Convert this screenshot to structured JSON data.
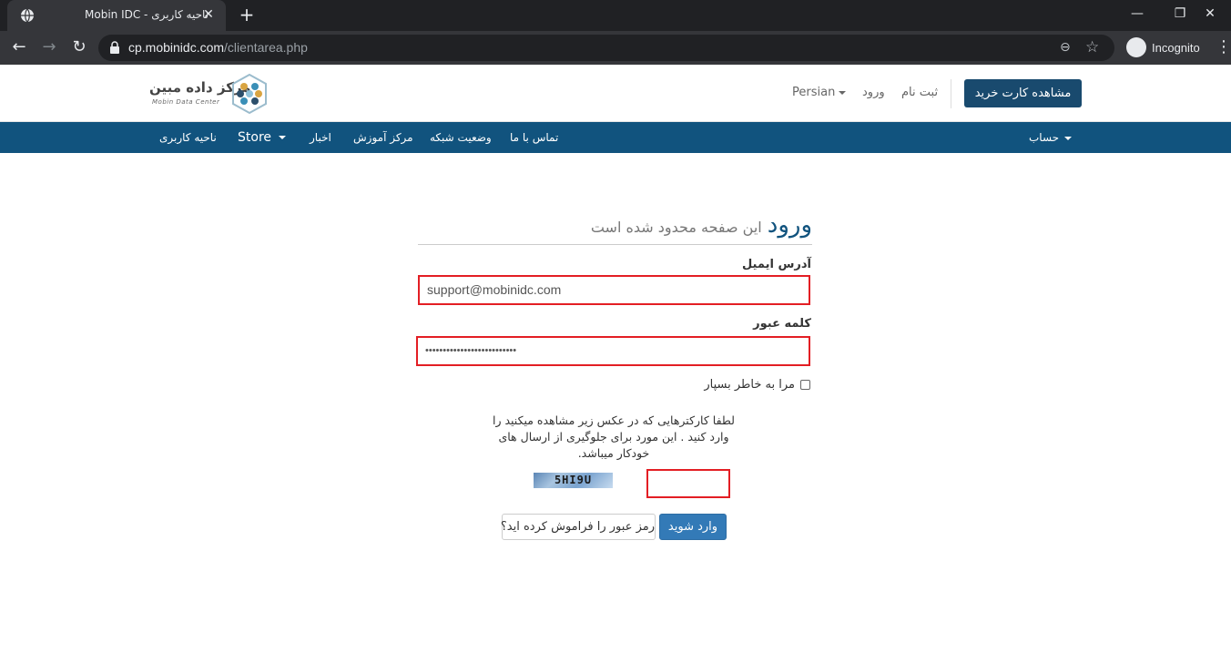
{
  "browser": {
    "tab_title": "Mobin IDC - ناحیه کاربری",
    "url_host": "cp.mobinidc.com",
    "url_path": "/clientarea.php",
    "incognito_label": "Incognito"
  },
  "header": {
    "logo_fa": "مرکز داده مبین",
    "logo_en": "Mobin Data Center",
    "language": "Persian",
    "login_link": "ورود",
    "register_link": "ثبت نام",
    "cart_button": "مشاهده کارت خرید"
  },
  "nav": {
    "client_area": "ناحیه کاربری",
    "store": "Store",
    "news": "اخبار",
    "education": "مرکز آموزش",
    "network_status": "وضعیت شبکه",
    "contact": "تماس با ما",
    "account": "حساب"
  },
  "login": {
    "title": "ورود",
    "subtitle": "این صفحه محدود شده است",
    "email_label": "آدرس ایمیل",
    "email_value": "support@mobinidc.com",
    "password_label": "کلمه عبور",
    "password_value": "••••••••••••••••••••••••••",
    "remember_label": "مرا به خاطر بسپار",
    "captcha_instructions": "لطفا کارکترهایی که در عکس زیر مشاهده میکنید را وارد کنید . این مورد برای جلوگیری از ارسال های خودکار میباشد.",
    "captcha_code": "5HI9U",
    "submit_button": "وارد شوید",
    "forgot_button": "رمز عبور را فراموش کرده اید؟"
  },
  "colors": {
    "nav_bg": "#11537e",
    "cart_btn_bg": "#194a6e",
    "highlight_border": "#e31e24",
    "login_btn_bg": "#337ab7"
  }
}
